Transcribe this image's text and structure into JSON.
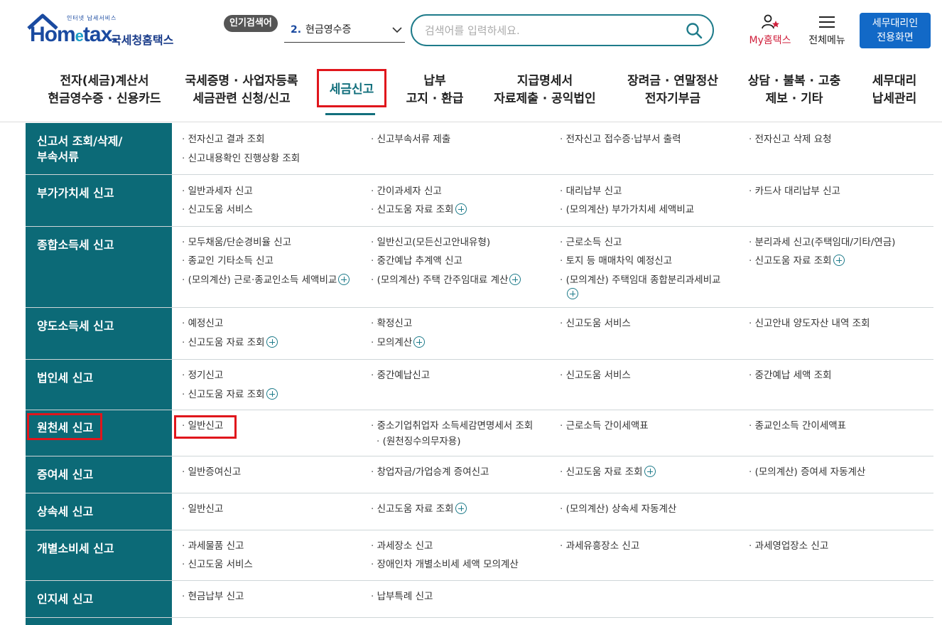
{
  "header": {
    "logo_small": "인터넷 납세서비스",
    "logo_text_a": "Hom",
    "logo_text_e": "e",
    "logo_text_b": "tax.",
    "logo_kr": "국세청홈택스",
    "popular_label": "인기검색어",
    "popular_rank": "2.",
    "popular_keyword": "현금영수증",
    "search_placeholder": "검색어를 입력하세요.",
    "my_label": "My홈택스",
    "all_menu_label": "전체메뉴",
    "agent_button_line1": "세무대리인",
    "agent_button_line2": "전용화면"
  },
  "nav": [
    {
      "l1": "전자(세금)계산서",
      "l2": "현금영수증 · 신용카드"
    },
    {
      "l1": "국세증명 · 사업자등록",
      "l2": "세금관련 신청/신고"
    },
    {
      "l1": "세금신고",
      "l2": ""
    },
    {
      "l1": "납부",
      "l2": "고지 · 환급"
    },
    {
      "l1": "지급명세서",
      "l2": "자료제출 · 공익법인"
    },
    {
      "l1": "장려금 · 연말정산",
      "l2": "전자기부금"
    },
    {
      "l1": "상담 · 불복 · 고충",
      "l2": "제보 · 기타"
    },
    {
      "l1": "세무대리",
      "l2": "납세관리"
    }
  ],
  "rows": [
    {
      "cat": "신고서 조회/삭제/\n부속서류",
      "links": [
        "전자신고 결과 조회",
        "신고부속서류 제출",
        "전자신고 접수증·납부서 출력",
        "전자신고 삭제 요청",
        "신고내용확인 진행상황 조회"
      ]
    },
    {
      "cat": "부가가치세 신고",
      "links": [
        "일반과세자 신고",
        "간이과세자 신고",
        "대리납부 신고",
        "카드사 대리납부 신고",
        "신고도움 서비스",
        "신고도움 자료 조회",
        "(모의계산) 부가가치세 세액비교"
      ]
    },
    {
      "cat": "종합소득세 신고",
      "links": [
        "모두채움/단순경비율 신고",
        "일반신고(모든신고안내유형)",
        "근로소득 신고",
        "분리과세 신고(주택임대/기타/연금)",
        "종교인 기타소득 신고",
        "중간예납 추계액 신고",
        "토지 등 매매차익 예정신고",
        "신고도움 자료 조회",
        "(모의계산) 근로·종교인소득 세액비교",
        "(모의계산) 주택 간주임대료 계산",
        "(모의계산) 주택임대 종합분리과세비교"
      ]
    },
    {
      "cat": "양도소득세 신고",
      "links": [
        "예정신고",
        "확정신고",
        "신고도움 서비스",
        "신고안내 양도자산 내역 조회",
        "신고도움 자료 조회",
        "모의계산"
      ]
    },
    {
      "cat": "법인세 신고",
      "links": [
        "정기신고",
        "중간예납신고",
        "신고도움 서비스",
        "중간예납 세액 조회",
        "신고도움 자료 조회"
      ]
    },
    {
      "cat": "원천세 신고",
      "links": [
        "일반신고",
        "중소기업취업자 소득세감면명세서 조회",
        "(원천징수의무자용)",
        "근로소득 간이세액표",
        "종교인소득 간이세액표"
      ]
    },
    {
      "cat": "증여세 신고",
      "links": [
        "일반증여신고",
        "창업자금/가업승계 증여신고",
        "신고도움 자료 조회",
        "(모의계산) 증여세 자동계산"
      ]
    },
    {
      "cat": "상속세 신고",
      "links": [
        "일반신고",
        "신고도움 자료 조회",
        "(모의계산) 상속세 자동계산"
      ]
    },
    {
      "cat": "개별소비세 신고",
      "links": [
        "과세물품 신고",
        "과세장소 신고",
        "과세유흥장소 신고",
        "과세영업장소 신고",
        "신고도움 서비스",
        "장애인차 개별소비세 세액 모의계산"
      ]
    },
    {
      "cat": "인지세 신고",
      "links": [
        "현금납부 신고",
        "납부특례 신고"
      ]
    }
  ],
  "colors": {
    "teal": "#0c6a77",
    "highlight": "#e0161c",
    "agent_btn": "#1269c7",
    "my_red": "#d0213d"
  }
}
